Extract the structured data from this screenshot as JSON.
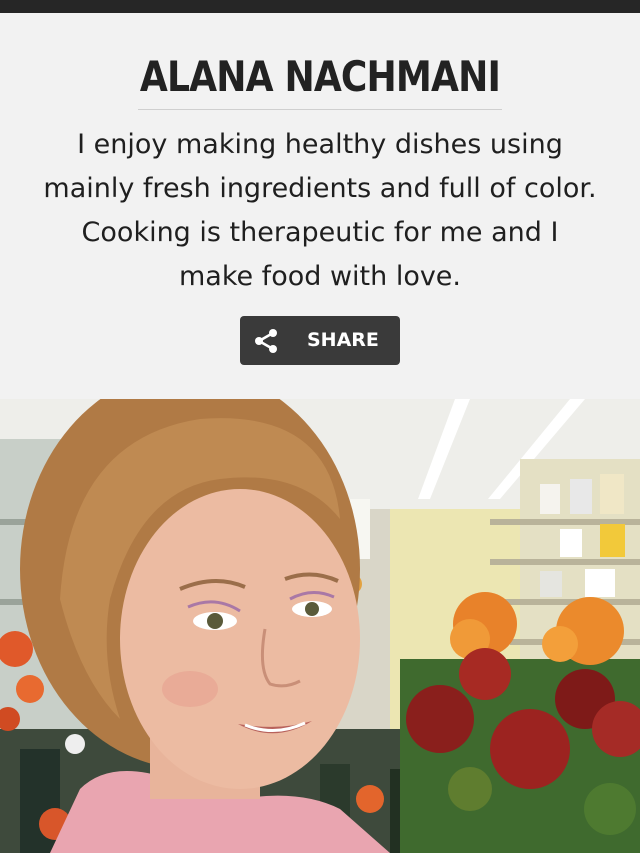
{
  "profile": {
    "name": "ALANA NACHMANI",
    "bio_lines": [
      "I enjoy making healthy dishes using",
      "mainly fresh ingredients and full of color.",
      "Cooking is therapeutic for me and I",
      "make food with love."
    ]
  },
  "share": {
    "label": "SHARE",
    "icon": "share-icon"
  },
  "photo": {
    "subject": "author-photo"
  },
  "colors": {
    "top_bar": "#262626",
    "background": "#f2f2f2",
    "button": "#3a3a3a",
    "text": "#1f1f1f"
  }
}
